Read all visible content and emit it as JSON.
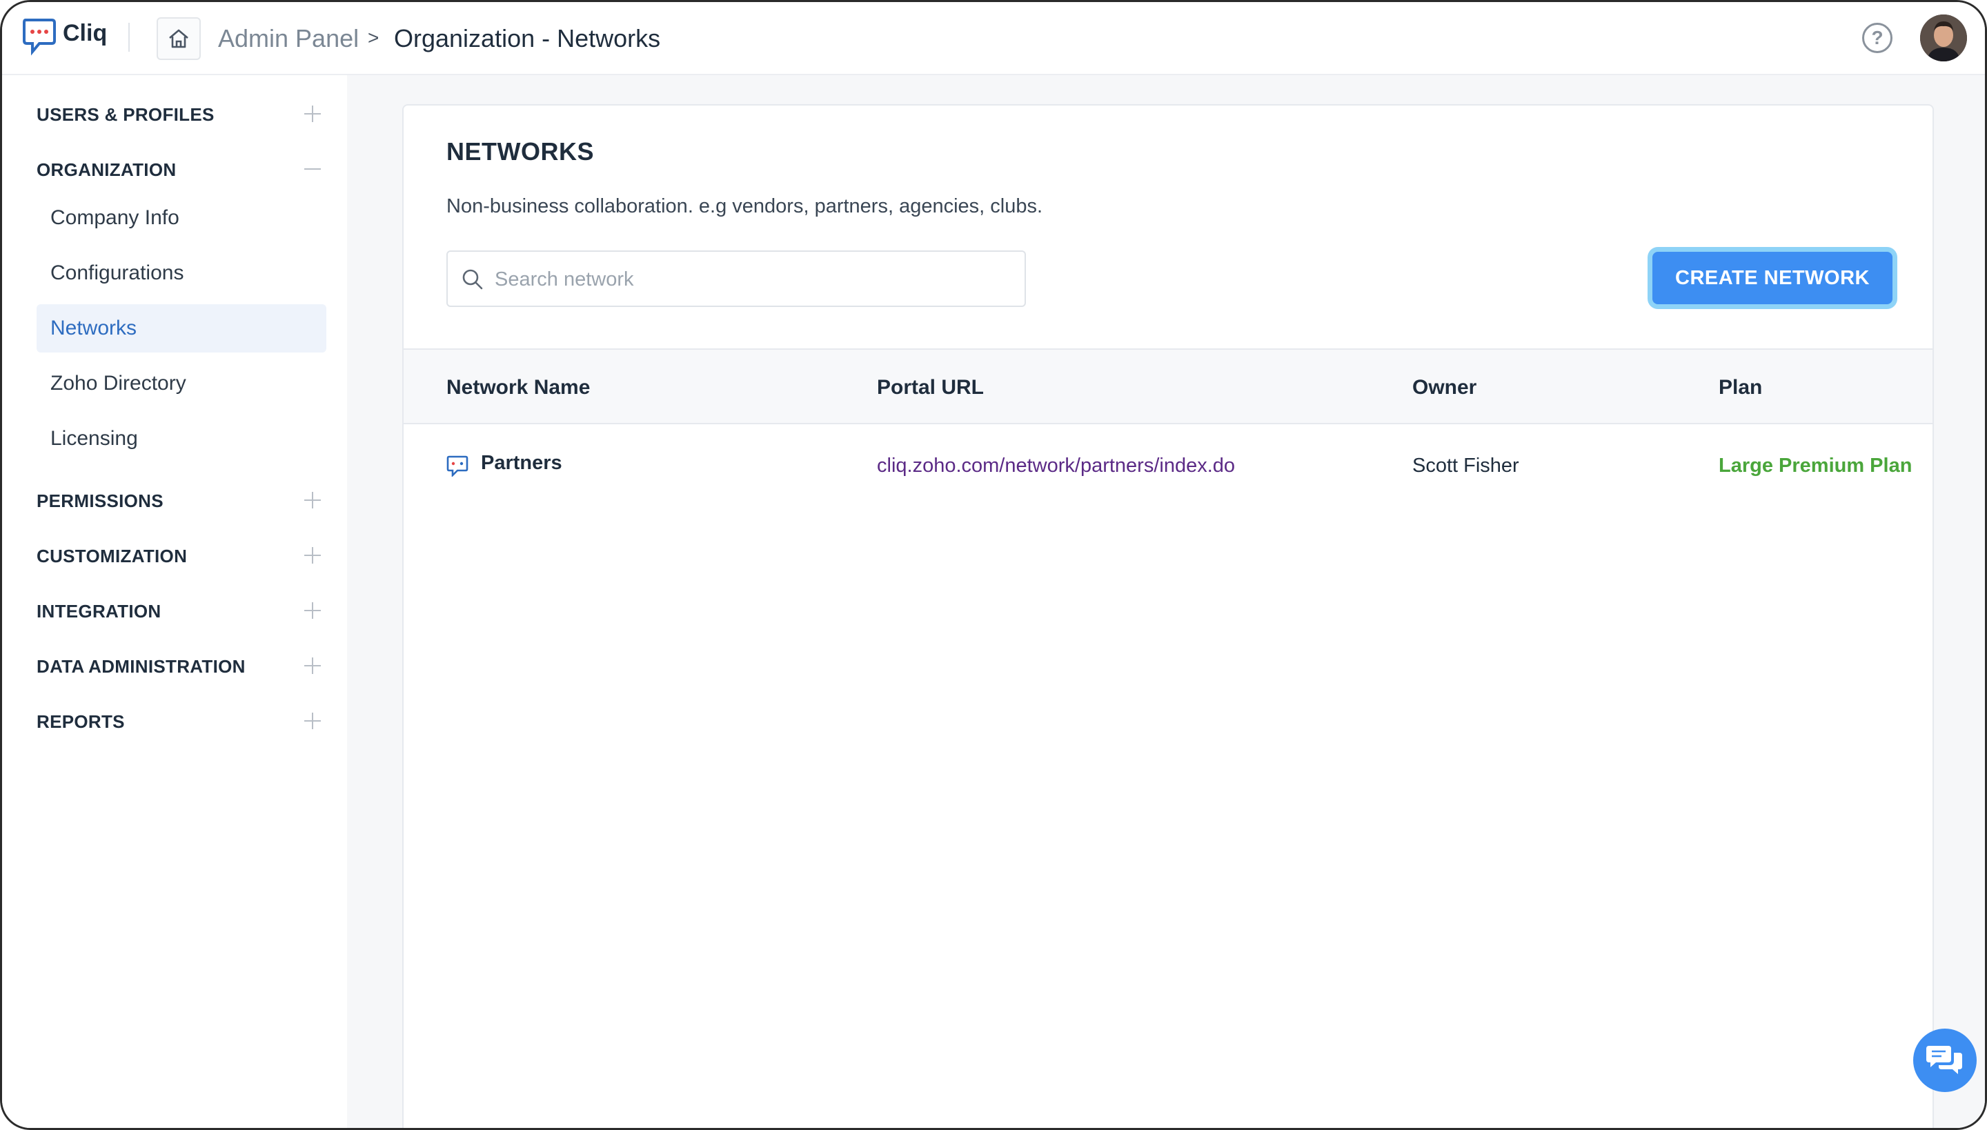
{
  "app": {
    "brand": "Cliq",
    "brand_color": "#1f2d3d",
    "logo_icon": "cliq-chat-logo-icon"
  },
  "header": {
    "breadcrumb_root": "Admin Panel",
    "breadcrumb_separator": ">",
    "breadcrumb_current": "Organization - Networks",
    "home_icon": "home-icon",
    "help_icon": "help-icon",
    "help_glyph": "?"
  },
  "sidebar": {
    "sections": [
      {
        "label": "USERS & PROFILES",
        "expanded": false
      },
      {
        "label": "ORGANIZATION",
        "expanded": true,
        "items": [
          {
            "label": "Company Info",
            "active": false
          },
          {
            "label": "Configurations",
            "active": false
          },
          {
            "label": "Networks",
            "active": true
          },
          {
            "label": "Zoho Directory",
            "active": false
          },
          {
            "label": "Licensing",
            "active": false
          }
        ]
      },
      {
        "label": "PERMISSIONS",
        "expanded": false
      },
      {
        "label": "CUSTOMIZATION",
        "expanded": false
      },
      {
        "label": "INTEGRATION",
        "expanded": false
      },
      {
        "label": "DATA ADMINISTRATION",
        "expanded": false
      },
      {
        "label": "REPORTS",
        "expanded": false
      }
    ],
    "active_color": "#2d6cc0"
  },
  "networks": {
    "title": "NETWORKS",
    "description": "Non-business collaboration. e.g vendors, partners, agencies, clubs.",
    "search_placeholder": "Search network",
    "search_value": "",
    "create_label": "CREATE NETWORK",
    "accent": "#3d8ef2",
    "columns": [
      "Network Name",
      "Portal URL",
      "Owner",
      "Plan"
    ],
    "rows": [
      {
        "name": "Partners",
        "url": "cliq.zoho.com/network/partners/index.do",
        "owner": "Scott Fisher",
        "plan": "Large Premium Plan",
        "plan_color": "#4aa63b"
      }
    ]
  },
  "chat_fab_icon": "chat-bubbles-icon"
}
